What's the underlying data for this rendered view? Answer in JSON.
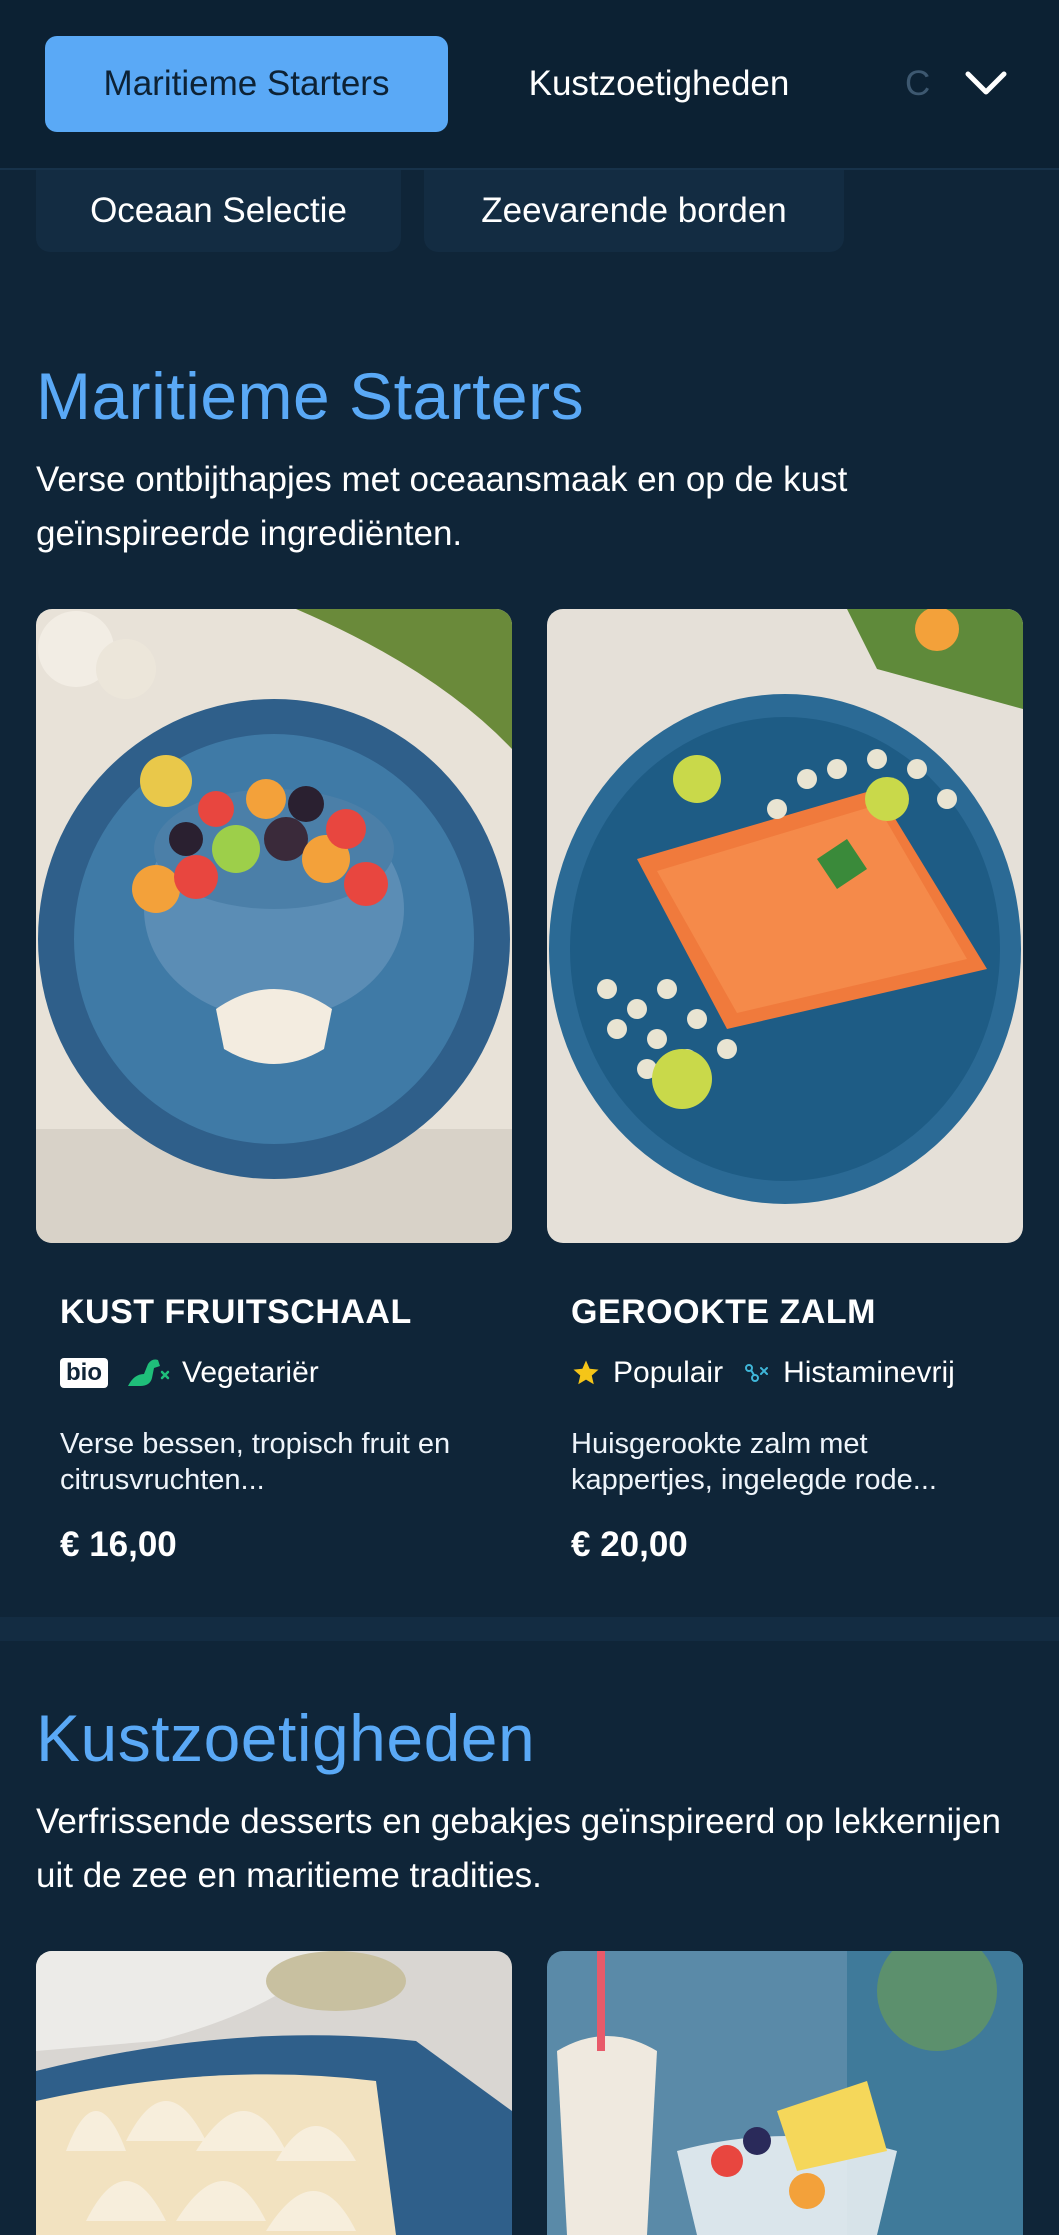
{
  "nav": {
    "tabs": [
      {
        "label": "Maritieme Starters",
        "active": true
      },
      {
        "label": "Kustzoetigheden",
        "active": false
      },
      {
        "label": "C",
        "active": false
      }
    ],
    "expand_icon": "chevron-down-icon",
    "pills": [
      "Oceaan Selectie",
      "Zeevarende borden"
    ]
  },
  "sections": [
    {
      "title": "Maritieme Starters",
      "description": "Verse ontbijthapjes met oceaansmaak en op de kust geïnspireerde ingrediënten.",
      "items": [
        {
          "name": "KUST FRUITSCHAAL",
          "tags": [
            {
              "icon": "bio-badge",
              "label": "bio",
              "text": ""
            },
            {
              "icon": "dinosaur-icon",
              "label": "",
              "text": "Vegetariër"
            }
          ],
          "description": "Verse bessen, tropisch fruit en citrusvruchten...",
          "price": "€ 16,00"
        },
        {
          "name": "GEROOKTE ZALM",
          "tags": [
            {
              "icon": "star-icon",
              "label": "",
              "text": "Populair"
            },
            {
              "icon": "histamine-free-icon",
              "label": "",
              "text": "Histaminevrij"
            }
          ],
          "description": "Huisgerookte zalm met kappertjes, ingelegde rode...",
          "price": "€ 20,00"
        }
      ]
    },
    {
      "title": "Kustzoetigheden",
      "description": "Verfrissende desserts en gebakjes geïnspireerd op lekkernijen uit de zee en maritieme tradities."
    }
  ],
  "colors": {
    "background": "#0f2538",
    "accent": "#5aa9f6",
    "card": "#132c42",
    "star": "#f5c518",
    "vegetarian": "#1fbf7a",
    "histamine": "#3fb6d8"
  }
}
